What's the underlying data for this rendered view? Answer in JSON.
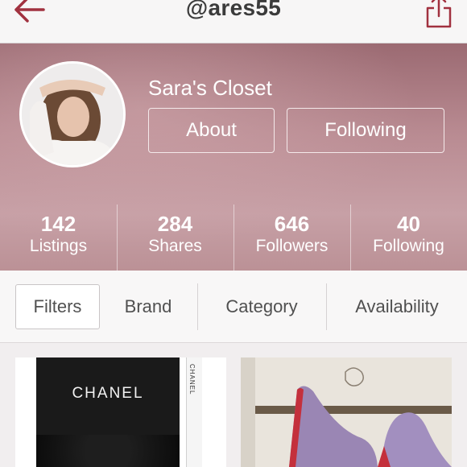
{
  "header": {
    "username": "@ares55",
    "back_icon": "back-arrow-icon",
    "share_icon": "share-icon",
    "accent": "#a1313f"
  },
  "profile": {
    "closet_name": "Sara's Closet",
    "about_label": "About",
    "following_button_label": "Following",
    "stats": [
      {
        "value": "142",
        "label": "Listings"
      },
      {
        "value": "284",
        "label": "Shares"
      },
      {
        "value": "646",
        "label": "Followers"
      },
      {
        "value": "40",
        "label": "Following"
      }
    ]
  },
  "filters": {
    "filters_label": "Filters",
    "brand_label": "Brand",
    "category_label": "Category",
    "availability_label": "Availability"
  },
  "listings": [
    {
      "image": "chanel-wallet-photo",
      "box_text": "CHANEL",
      "side_text": "CHANEL"
    },
    {
      "image": "purple-suede-pumps-photo"
    }
  ]
}
